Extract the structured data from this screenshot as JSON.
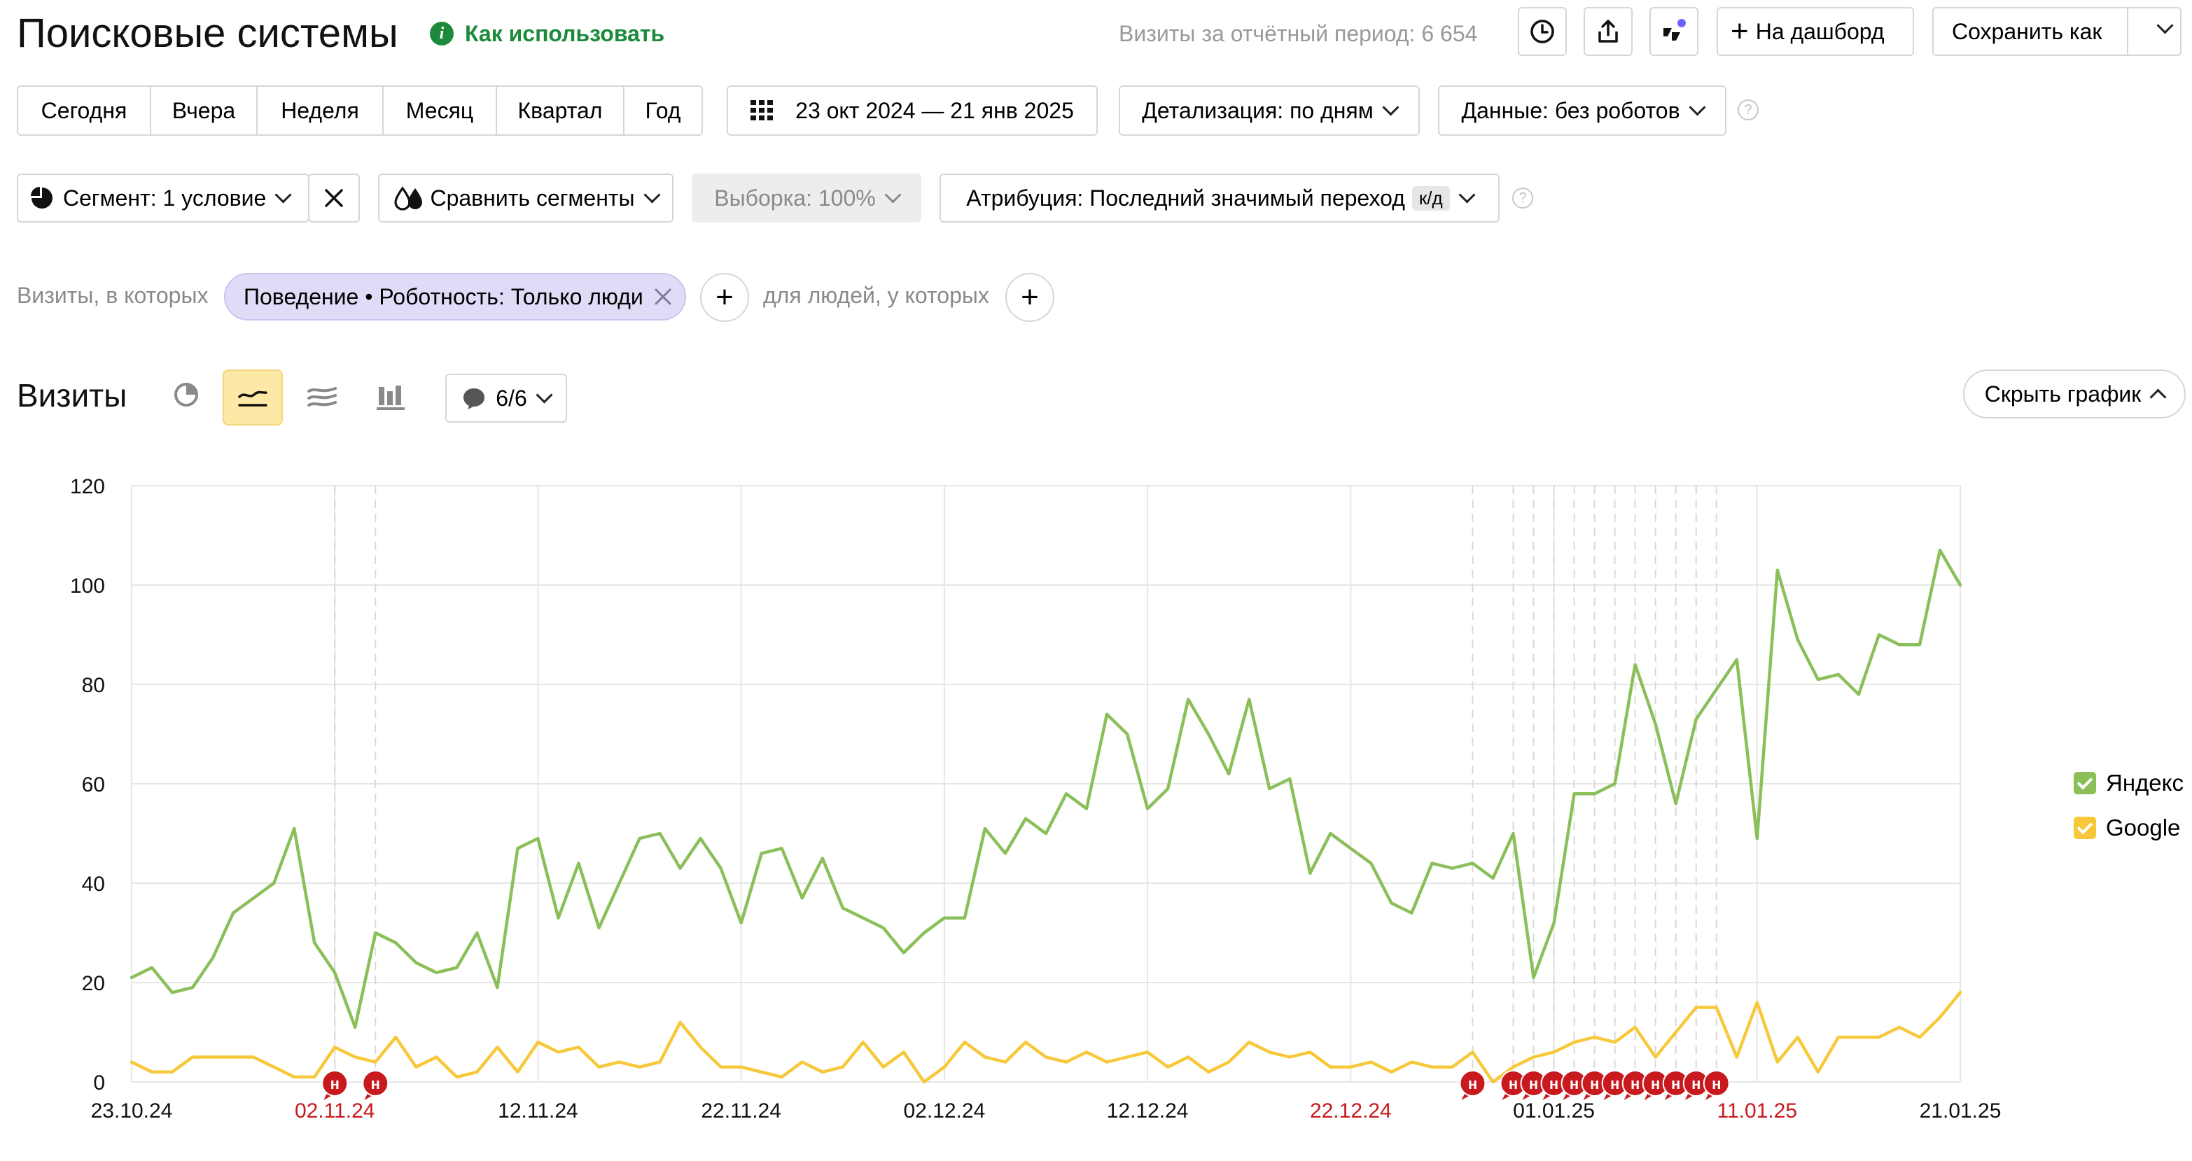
{
  "header": {
    "title": "Поисковые системы",
    "how_to_use": "Как использовать",
    "visits_period": "Визиты за отчётный период: 6 654",
    "add_to_dashboard": "На дашборд",
    "save_as": "Сохранить как"
  },
  "period_tabs": [
    "Сегодня",
    "Вчера",
    "Неделя",
    "Месяц",
    "Квартал",
    "Год"
  ],
  "date_range": "23 окт 2024 — 21 янв 2025",
  "detalization": "Детализация: по дням",
  "data_filter": "Данные: без роботов",
  "segment": "Сегмент: 1 условие",
  "compare_segments": "Сравнить сегменты",
  "sampling": "Выборка: 100%",
  "attribution": "Атрибуция: Последний значимый переход",
  "attribution_badge": "к/д",
  "filter_row": {
    "visits_where": "Визиты, в которых",
    "chip": "Поведение • Роботность: Только люди",
    "people_where": "для людей, у которых"
  },
  "chart_header": {
    "title": "Визиты",
    "annotations_count": "6/6",
    "hide_chart": "Скрыть график"
  },
  "colors": {
    "yandex": "#8bbf5a",
    "google": "#f7c83a",
    "note": "#c8191e",
    "holiday_label": "#c8191e",
    "chip_bg": "#dedcf7",
    "active_btn": "#fde9a5"
  },
  "chart_data": {
    "type": "line",
    "ylim": [
      0,
      120
    ],
    "yticks": [
      0,
      20,
      40,
      60,
      80,
      100,
      120
    ],
    "x_tick_labels": [
      {
        "i": 0,
        "label": "23.10.24",
        "holiday": false
      },
      {
        "i": 10,
        "label": "02.11.24",
        "holiday": true
      },
      {
        "i": 20,
        "label": "12.11.24",
        "holiday": false
      },
      {
        "i": 30,
        "label": "22.11.24",
        "holiday": false
      },
      {
        "i": 40,
        "label": "02.12.24",
        "holiday": false
      },
      {
        "i": 50,
        "label": "12.12.24",
        "holiday": false
      },
      {
        "i": 60,
        "label": "22.12.24",
        "holiday": true
      },
      {
        "i": 70,
        "label": "01.01.25",
        "holiday": false
      },
      {
        "i": 80,
        "label": "11.01.25",
        "holiday": true
      },
      {
        "i": 90,
        "label": "21.01.25",
        "holiday": false
      }
    ],
    "note_days": [
      10,
      12,
      66,
      68,
      69,
      70,
      71,
      72,
      73,
      74,
      75,
      76,
      77,
      78
    ],
    "note_label": "н",
    "series": [
      {
        "name": "Яндекс",
        "values": [
          21,
          23,
          18,
          19,
          25,
          34,
          37,
          40,
          51,
          28,
          22,
          11,
          30,
          28,
          24,
          22,
          23,
          30,
          19,
          47,
          49,
          33,
          44,
          31,
          40,
          49,
          50,
          43,
          49,
          43,
          32,
          46,
          47,
          37,
          45,
          35,
          33,
          31,
          26,
          30,
          33,
          33,
          51,
          46,
          53,
          50,
          58,
          55,
          74,
          70,
          55,
          59,
          77,
          70,
          62,
          77,
          59,
          61,
          42,
          50,
          47,
          44,
          36,
          34,
          44,
          43,
          44,
          41,
          50,
          21,
          32,
          58,
          58,
          60,
          84,
          72,
          56,
          73,
          79,
          85,
          49,
          103,
          89,
          81,
          82,
          78,
          90,
          88,
          88,
          107,
          100
        ]
      },
      {
        "name": "Google",
        "values": [
          4,
          2,
          2,
          5,
          5,
          5,
          5,
          3,
          1,
          1,
          7,
          5,
          4,
          9,
          3,
          5,
          1,
          2,
          7,
          2,
          8,
          6,
          7,
          3,
          4,
          3,
          4,
          12,
          7,
          3,
          3,
          2,
          1,
          4,
          2,
          3,
          8,
          3,
          6,
          0,
          3,
          8,
          5,
          4,
          8,
          5,
          4,
          6,
          4,
          5,
          6,
          3,
          5,
          2,
          4,
          8,
          6,
          5,
          6,
          3,
          3,
          4,
          2,
          4,
          3,
          3,
          6,
          0,
          3,
          5,
          6,
          8,
          9,
          8,
          11,
          5,
          10,
          15,
          15,
          5,
          16,
          4,
          9,
          2,
          9,
          9,
          9,
          11,
          9,
          13,
          18
        ]
      }
    ]
  }
}
